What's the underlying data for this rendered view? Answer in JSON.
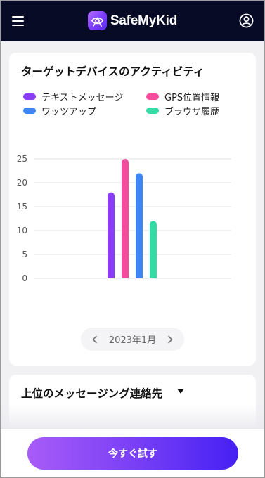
{
  "header": {
    "brand": "SafeMyKid",
    "menu_icon": "hamburger-menu-icon",
    "account_icon": "user-circle-icon"
  },
  "activity": {
    "title": "ターゲットデバイスのアクティビティ",
    "legend": [
      {
        "label": "テキストメッセージ",
        "color": "#8b3cf7"
      },
      {
        "label": "GPS位置情報",
        "color": "#f64a9c"
      },
      {
        "label": "ワッツアップ",
        "color": "#3d86f6"
      },
      {
        "label": "ブラウザ履歴",
        "color": "#35dba5"
      }
    ],
    "month": "2023年1月",
    "prev_icon": "chevron-left-icon",
    "next_icon": "chevron-right-icon"
  },
  "chart_data": {
    "type": "bar",
    "categories": [
      "テキストメッセージ",
      "GPS位置情報",
      "ワッツアップ",
      "ブラウザ履歴"
    ],
    "values": [
      18,
      25,
      22,
      12
    ],
    "colors": [
      "#8b3cf7",
      "#f64a9c",
      "#3d86f6",
      "#35dba5"
    ],
    "ylim": [
      0,
      25
    ],
    "yticks": [
      0,
      5,
      10,
      15,
      20,
      25
    ],
    "grid": true,
    "legend_position": "top"
  },
  "contacts": {
    "title": "上位のメッセージング連絡先"
  },
  "cta": {
    "label": "今すぐ試す"
  }
}
